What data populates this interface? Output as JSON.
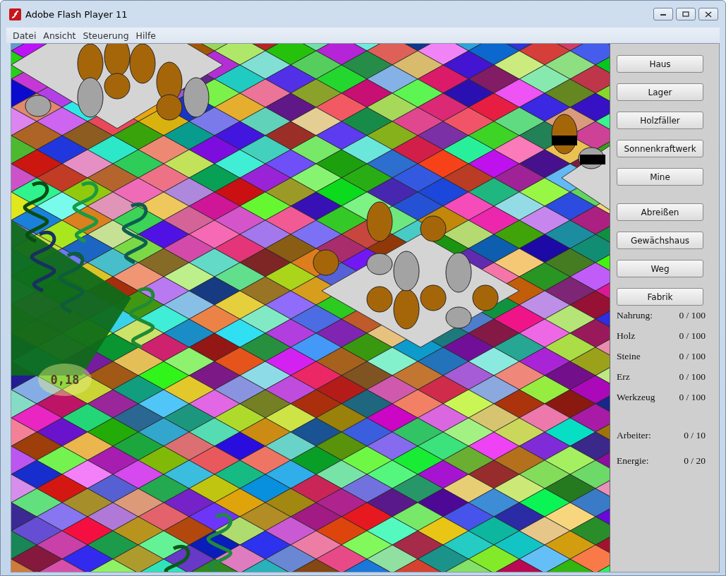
{
  "window": {
    "title": "Adobe Flash Player 11"
  },
  "menu": [
    "Datei",
    "Ansicht",
    "Steuerung",
    "Hilfe"
  ],
  "map": {
    "tile_label": "0,18"
  },
  "buttons": [
    "Haus",
    "Lager",
    "Holzfäller",
    "Sonnenkraftwerk",
    "Mine",
    "Abreißen",
    "Gewächshaus",
    "Weg",
    "Fabrik"
  ],
  "resources": [
    {
      "label": "Nahrung:",
      "value": "0 / 100"
    },
    {
      "label": "Holz",
      "value": "0 / 100"
    },
    {
      "label": "Steine",
      "value": "0 / 100"
    },
    {
      "label": "Erz",
      "value": "0 / 100"
    },
    {
      "label": "Werkzeug",
      "value": "0 / 100"
    }
  ],
  "population": [
    {
      "label": "Arbeiter:",
      "value": "0 / 10"
    },
    {
      "label": "Energie:",
      "value": "0 / 20"
    }
  ]
}
